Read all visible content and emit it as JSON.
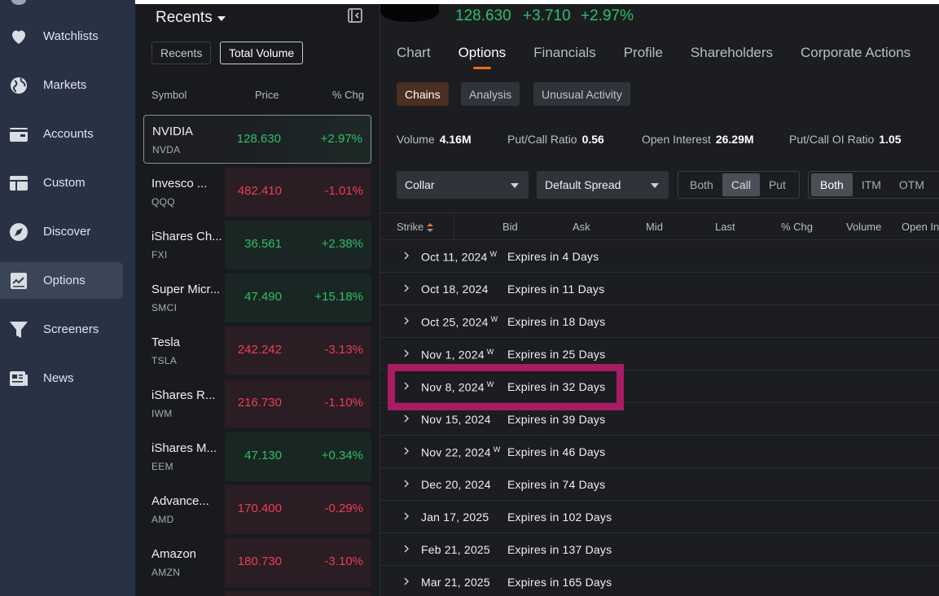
{
  "nav": {
    "items": [
      {
        "label": "Watchlists",
        "icon": "heart-icon",
        "active": false
      },
      {
        "label": "Markets",
        "icon": "globe-icon",
        "active": false
      },
      {
        "label": "Accounts",
        "icon": "wallet-icon",
        "active": false
      },
      {
        "label": "Custom",
        "icon": "layout-icon",
        "active": false
      },
      {
        "label": "Discover",
        "icon": "compass-icon",
        "active": false
      },
      {
        "label": "Options",
        "icon": "chart-icon",
        "active": true
      },
      {
        "label": "Screeners",
        "icon": "filter-icon",
        "active": false
      },
      {
        "label": "News",
        "icon": "newspaper-icon",
        "active": false
      }
    ]
  },
  "watchlist": {
    "title": "Recents",
    "filters": [
      {
        "label": "Recents",
        "active": false
      },
      {
        "label": "Total Volume",
        "active": true
      }
    ],
    "columns": {
      "symbol": "Symbol",
      "price": "Price",
      "change": "% Chg"
    },
    "rows": [
      {
        "name": "NVIDIA",
        "symbol": "NVDA",
        "price": "128.630",
        "change": "+2.97%",
        "dir": "up",
        "selected": true
      },
      {
        "name": "Invesco ...",
        "symbol": "QQQ",
        "price": "482.410",
        "change": "-1.01%",
        "dir": "dn",
        "selected": false
      },
      {
        "name": "iShares Ch...",
        "symbol": "FXI",
        "price": "36.561",
        "change": "+2.38%",
        "dir": "up",
        "selected": false
      },
      {
        "name": "Super Micr...",
        "symbol": "SMCI",
        "price": "47.490",
        "change": "+15.18%",
        "dir": "up",
        "selected": false
      },
      {
        "name": "Tesla",
        "symbol": "TSLA",
        "price": "242.242",
        "change": "-3.13%",
        "dir": "dn",
        "selected": false
      },
      {
        "name": "iShares R...",
        "symbol": "IWM",
        "price": "216.730",
        "change": "-1.10%",
        "dir": "dn",
        "selected": false
      },
      {
        "name": "iShares M...",
        "symbol": "EEM",
        "price": "47.130",
        "change": "+0.34%",
        "dir": "up",
        "selected": false
      },
      {
        "name": "Advance...",
        "symbol": "AMD",
        "price": "170.400",
        "change": "-0.29%",
        "dir": "dn",
        "selected": false
      },
      {
        "name": "Amazon",
        "symbol": "AMZN",
        "price": "180.730",
        "change": "-3.10%",
        "dir": "dn",
        "selected": false
      }
    ]
  },
  "quote": {
    "last": "128.630",
    "change": "+3.710",
    "change_pct": "+2.97%"
  },
  "tabs": [
    {
      "label": "Chart",
      "active": false
    },
    {
      "label": "Options",
      "active": true
    },
    {
      "label": "Financials",
      "active": false
    },
    {
      "label": "Profile",
      "active": false
    },
    {
      "label": "Shareholders",
      "active": false
    },
    {
      "label": "Corporate Actions",
      "active": false
    }
  ],
  "subtabs": [
    {
      "label": "Chains",
      "active": true
    },
    {
      "label": "Analysis",
      "active": false
    },
    {
      "label": "Unusual Activity",
      "active": false
    }
  ],
  "stats": {
    "volume_label": "Volume",
    "volume": "4.16M",
    "pcr_label": "Put/Call Ratio",
    "pcr": "0.56",
    "oi_label": "Open Interest",
    "oi": "26.29M",
    "pcoi_label": "Put/Call OI Ratio",
    "pcoi": "1.05"
  },
  "controls": {
    "strategy": "Collar",
    "spread": "Default Spread",
    "side_options": [
      "Both",
      "Call",
      "Put"
    ],
    "side_selected": "Call",
    "money_options": [
      "Both",
      "ITM",
      "OTM"
    ],
    "money_selected": "Both"
  },
  "grid": {
    "headers": [
      "Strike",
      "Bid",
      "Ask",
      "Mid",
      "Last",
      "% Chg",
      "Volume",
      "Open In"
    ],
    "weekly_marker": "W",
    "expirations": [
      {
        "date": "Oct 11, 2024",
        "weekly": true,
        "expires": "Expires in 4 Days"
      },
      {
        "date": "Oct 18, 2024",
        "weekly": false,
        "expires": "Expires in 11 Days"
      },
      {
        "date": "Oct 25, 2024",
        "weekly": true,
        "expires": "Expires in 18 Days"
      },
      {
        "date": "Nov 1, 2024",
        "weekly": true,
        "expires": "Expires in 25 Days"
      },
      {
        "date": "Nov 8, 2024",
        "weekly": true,
        "expires": "Expires in 32 Days"
      },
      {
        "date": "Nov 15, 2024",
        "weekly": false,
        "expires": "Expires in 39 Days"
      },
      {
        "date": "Nov 22, 2024",
        "weekly": true,
        "expires": "Expires in 46 Days"
      },
      {
        "date": "Dec 20, 2024",
        "weekly": false,
        "expires": "Expires in 74 Days"
      },
      {
        "date": "Jan 17, 2025",
        "weekly": false,
        "expires": "Expires in 102 Days"
      },
      {
        "date": "Feb 21, 2025",
        "weekly": false,
        "expires": "Expires in 137 Days"
      },
      {
        "date": "Mar 21, 2025",
        "weekly": false,
        "expires": "Expires in 165 Days"
      }
    ]
  },
  "colors": {
    "up": "#2fbf6b",
    "down": "#ee3d57",
    "accent": "#ef6a1f",
    "highlight": "#a91b63"
  }
}
